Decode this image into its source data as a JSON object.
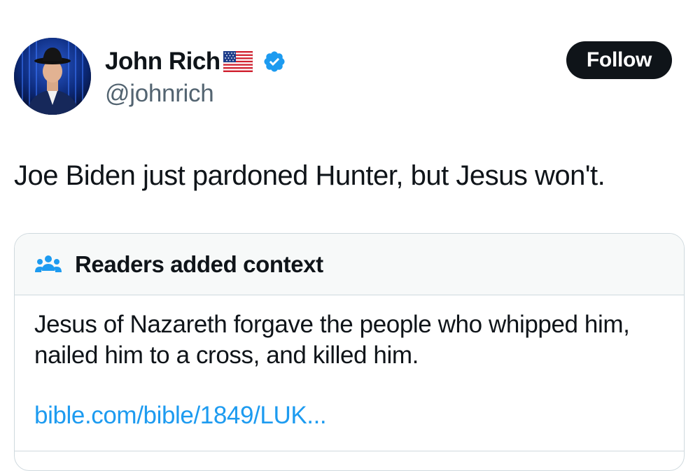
{
  "author": {
    "display_name": "John Rich",
    "handle": "@johnrich",
    "flag_icon": "us-flag-emoji-icon",
    "verified_icon": "verified-badge-icon",
    "verified_color": "#1d9bf0"
  },
  "follow_button": {
    "label": "Follow"
  },
  "tweet": {
    "text": "Joe Biden just pardoned Hunter, but Jesus won't."
  },
  "community_note": {
    "icon": "people-icon",
    "title": "Readers added context",
    "body": "Jesus of Nazareth forgave the people who whipped him, nailed him to a cross, and killed him.",
    "link_text": "bible.com/bible/1849/LUK..."
  },
  "colors": {
    "text_primary": "#0f1419",
    "text_secondary": "#536471",
    "link": "#1d9bf0",
    "note_header_bg": "#f7f9f9",
    "border": "#cfd9de"
  }
}
